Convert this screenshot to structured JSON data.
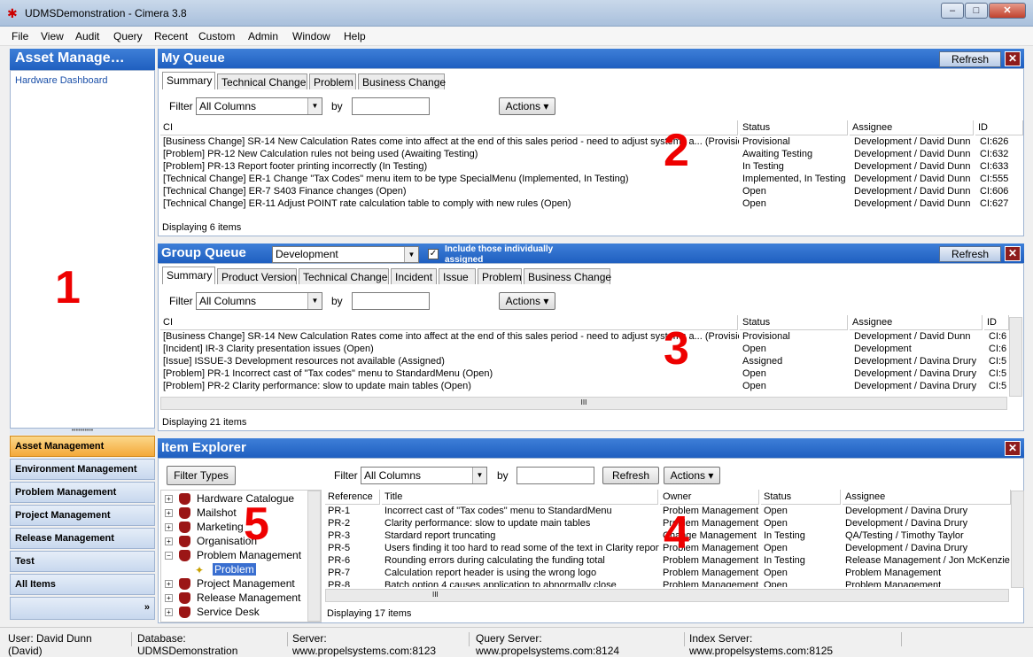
{
  "window": {
    "title": "UDMSDemonstration - Cimera 3.8",
    "min": "–",
    "max": "□",
    "close": "✕"
  },
  "menu": [
    "File",
    "View",
    "Audit",
    "Query",
    "Recent",
    "Custom",
    "Admin",
    "Window",
    "Help"
  ],
  "nav": {
    "header": "Asset Manage…",
    "link": "Hardware Dashboard",
    "marker": "1",
    "splitter": "••••••••••",
    "items": [
      "Asset Management",
      "Environment Management",
      "Problem Management",
      "Project Management",
      "Release Management",
      "Test",
      "All Items"
    ],
    "more": "»"
  },
  "my_queue": {
    "title": "My Queue",
    "refresh": "Refresh",
    "close": "✕",
    "marker": "2",
    "tabs": [
      "Summary",
      "Technical Change",
      "Problem",
      "Business Change"
    ],
    "filter_label": "Filter",
    "filter_value": "All Columns",
    "by_label": "by",
    "actions": "Actions ▾",
    "columns": [
      "CI",
      "Status",
      "Assignee",
      "ID"
    ],
    "rows": [
      [
        "[Business Change] SR-14 New Calculation Rates come into affect at the end of this sales period - need to adjust systems a... (Provisional)",
        "Provisional",
        "Development / David Dunn",
        "CI:626"
      ],
      [
        "[Problem] PR-12 New Calculation rules not being used (Awaiting Testing)",
        "Awaiting Testing",
        "Development / David Dunn",
        "CI:632"
      ],
      [
        "[Problem] PR-13 Report footer printing incorrectly (In Testing)",
        "In Testing",
        "Development / David Dunn",
        "CI:633"
      ],
      [
        "[Technical Change] ER-1 Change \"Tax Codes\" menu item to be type SpecialMenu (Implemented, In Testing)",
        "Implemented, In Testing",
        "Development / David Dunn",
        "CI:555"
      ],
      [
        "[Technical Change] ER-7 S403 Finance changes (Open)",
        "Open",
        "Development / David Dunn",
        "CI:606"
      ],
      [
        "[Technical Change] ER-11 Adjust POINT rate calculation table to comply with new rules (Open)",
        "Open",
        "Development / David Dunn",
        "CI:627"
      ]
    ],
    "footer": "Displaying 6 items"
  },
  "group_queue": {
    "title": "Group Queue",
    "group": "Development",
    "include_label": "Include those individually assigned",
    "refresh": "Refresh",
    "close": "✕",
    "marker": "3",
    "tabs": [
      "Summary",
      "Product Version",
      "Technical Change",
      "Incident",
      "Issue",
      "Problem",
      "Business Change"
    ],
    "filter_label": "Filter",
    "filter_value": "All Columns",
    "by_label": "by",
    "actions": "Actions ▾",
    "columns": [
      "CI",
      "Status",
      "Assignee",
      "ID"
    ],
    "rows": [
      [
        "[Business Change] SR-14 New Calculation Rates come into affect at the end of this sales period - need to adjust systems a... (Provisional)",
        "Provisional",
        "Development / David Dunn",
        "CI:6"
      ],
      [
        "[Incident] IR-3 Clarity presentation issues (Open)",
        "Open",
        "Development",
        "CI:6"
      ],
      [
        "[Issue] ISSUE-3 Development resources not available (Assigned)",
        "Assigned",
        "Development / Davina Drury",
        "CI:5"
      ],
      [
        "[Problem] PR-1 Incorrect cast of \"Tax codes\" menu to StandardMenu (Open)",
        "Open",
        "Development / Davina Drury",
        "CI:5"
      ],
      [
        "[Problem] PR-2 Clarity performance: slow to update main tables (Open)",
        "Open",
        "Development / Davina Drury",
        "CI:5"
      ]
    ],
    "scroll_grip": "III",
    "footer": "Displaying 21 items"
  },
  "explorer": {
    "title": "Item Explorer",
    "close": "✕",
    "marker_tree": "5",
    "marker_list": "4",
    "filter_types": "Filter Types",
    "tree": [
      {
        "label": "Hardware Catalogue",
        "exp": "+"
      },
      {
        "label": "Mailshot",
        "exp": "+"
      },
      {
        "label": "Marketing",
        "exp": "+"
      },
      {
        "label": "Organisation",
        "exp": "+"
      },
      {
        "label": "Problem Management",
        "exp": "−"
      },
      {
        "label": "Problem",
        "exp": ""
      },
      {
        "label": "Project Management",
        "exp": "+"
      },
      {
        "label": "Release Management",
        "exp": "+"
      },
      {
        "label": "Service Desk",
        "exp": "+"
      }
    ],
    "filter_label": "Filter",
    "filter_value": "All Columns",
    "by_label": "by",
    "refresh": "Refresh",
    "actions": "Actions ▾",
    "columns": [
      "Reference",
      "Title",
      "Owner",
      "Status",
      "Assignee"
    ],
    "rows": [
      [
        "PR-1",
        "Incorrect cast of \"Tax codes\" menu to StandardMenu",
        "Problem Management",
        "Open",
        "Development / Davina Drury"
      ],
      [
        "PR-2",
        "Clarity performance: slow to update main tables",
        "Problem Management",
        "Open",
        "Development / Davina Drury"
      ],
      [
        "PR-3",
        "Stardard report truncating",
        "Change Management",
        "In Testing",
        "QA/Testing / Timothy Taylor"
      ],
      [
        "PR-5",
        "Users finding it too hard to read some of the text in Clarity reports",
        "Problem Management",
        "Open",
        "Development / Davina Drury"
      ],
      [
        "PR-6",
        "Rounding errors during calculating the funding total",
        "Problem Management",
        "In Testing",
        "Release Management / Jon McKenzie"
      ],
      [
        "PR-7",
        "Calculation report header is using the wrong logo",
        "Problem Management",
        "Open",
        "Problem Management"
      ],
      [
        "PR-8",
        "Batch option 4 causes application to abnormally close",
        "Problem Management",
        "Open",
        "Problem Management"
      ]
    ],
    "scroll_grip": "III",
    "footer": "Displaying 17 items"
  },
  "status": {
    "user": "User: David Dunn (David)",
    "database": "Database: UDMSDemonstration",
    "server": "Server: www.propelsystems.com:8123",
    "query_server": "Query Server: www.propelsystems.com:8124",
    "index_server": "Index Server: www.propelsystems.com:8125"
  }
}
